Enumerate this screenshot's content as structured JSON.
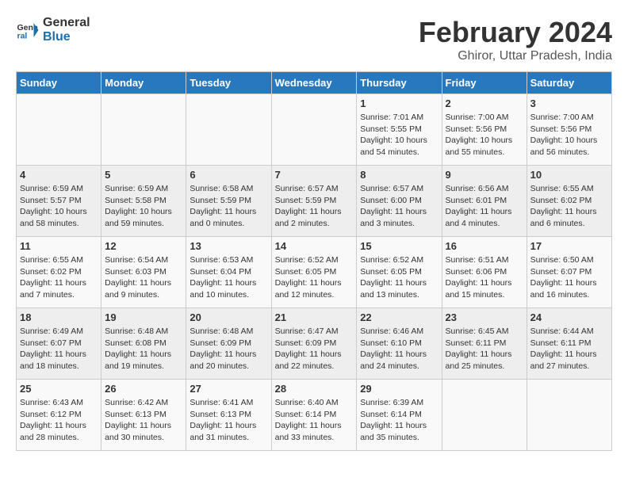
{
  "logo": {
    "line1": "General",
    "line2": "Blue"
  },
  "title": "February 2024",
  "location": "Ghiror, Uttar Pradesh, India",
  "days_of_week": [
    "Sunday",
    "Monday",
    "Tuesday",
    "Wednesday",
    "Thursday",
    "Friday",
    "Saturday"
  ],
  "weeks": [
    [
      {
        "day": "",
        "info": ""
      },
      {
        "day": "",
        "info": ""
      },
      {
        "day": "",
        "info": ""
      },
      {
        "day": "",
        "info": ""
      },
      {
        "day": "1",
        "info": "Sunrise: 7:01 AM\nSunset: 5:55 PM\nDaylight: 10 hours\nand 54 minutes."
      },
      {
        "day": "2",
        "info": "Sunrise: 7:00 AM\nSunset: 5:56 PM\nDaylight: 10 hours\nand 55 minutes."
      },
      {
        "day": "3",
        "info": "Sunrise: 7:00 AM\nSunset: 5:56 PM\nDaylight: 10 hours\nand 56 minutes."
      }
    ],
    [
      {
        "day": "4",
        "info": "Sunrise: 6:59 AM\nSunset: 5:57 PM\nDaylight: 10 hours\nand 58 minutes."
      },
      {
        "day": "5",
        "info": "Sunrise: 6:59 AM\nSunset: 5:58 PM\nDaylight: 10 hours\nand 59 minutes."
      },
      {
        "day": "6",
        "info": "Sunrise: 6:58 AM\nSunset: 5:59 PM\nDaylight: 11 hours\nand 0 minutes."
      },
      {
        "day": "7",
        "info": "Sunrise: 6:57 AM\nSunset: 5:59 PM\nDaylight: 11 hours\nand 2 minutes."
      },
      {
        "day": "8",
        "info": "Sunrise: 6:57 AM\nSunset: 6:00 PM\nDaylight: 11 hours\nand 3 minutes."
      },
      {
        "day": "9",
        "info": "Sunrise: 6:56 AM\nSunset: 6:01 PM\nDaylight: 11 hours\nand 4 minutes."
      },
      {
        "day": "10",
        "info": "Sunrise: 6:55 AM\nSunset: 6:02 PM\nDaylight: 11 hours\nand 6 minutes."
      }
    ],
    [
      {
        "day": "11",
        "info": "Sunrise: 6:55 AM\nSunset: 6:02 PM\nDaylight: 11 hours\nand 7 minutes."
      },
      {
        "day": "12",
        "info": "Sunrise: 6:54 AM\nSunset: 6:03 PM\nDaylight: 11 hours\nand 9 minutes."
      },
      {
        "day": "13",
        "info": "Sunrise: 6:53 AM\nSunset: 6:04 PM\nDaylight: 11 hours\nand 10 minutes."
      },
      {
        "day": "14",
        "info": "Sunrise: 6:52 AM\nSunset: 6:05 PM\nDaylight: 11 hours\nand 12 minutes."
      },
      {
        "day": "15",
        "info": "Sunrise: 6:52 AM\nSunset: 6:05 PM\nDaylight: 11 hours\nand 13 minutes."
      },
      {
        "day": "16",
        "info": "Sunrise: 6:51 AM\nSunset: 6:06 PM\nDaylight: 11 hours\nand 15 minutes."
      },
      {
        "day": "17",
        "info": "Sunrise: 6:50 AM\nSunset: 6:07 PM\nDaylight: 11 hours\nand 16 minutes."
      }
    ],
    [
      {
        "day": "18",
        "info": "Sunrise: 6:49 AM\nSunset: 6:07 PM\nDaylight: 11 hours\nand 18 minutes."
      },
      {
        "day": "19",
        "info": "Sunrise: 6:48 AM\nSunset: 6:08 PM\nDaylight: 11 hours\nand 19 minutes."
      },
      {
        "day": "20",
        "info": "Sunrise: 6:48 AM\nSunset: 6:09 PM\nDaylight: 11 hours\nand 20 minutes."
      },
      {
        "day": "21",
        "info": "Sunrise: 6:47 AM\nSunset: 6:09 PM\nDaylight: 11 hours\nand 22 minutes."
      },
      {
        "day": "22",
        "info": "Sunrise: 6:46 AM\nSunset: 6:10 PM\nDaylight: 11 hours\nand 24 minutes."
      },
      {
        "day": "23",
        "info": "Sunrise: 6:45 AM\nSunset: 6:11 PM\nDaylight: 11 hours\nand 25 minutes."
      },
      {
        "day": "24",
        "info": "Sunrise: 6:44 AM\nSunset: 6:11 PM\nDaylight: 11 hours\nand 27 minutes."
      }
    ],
    [
      {
        "day": "25",
        "info": "Sunrise: 6:43 AM\nSunset: 6:12 PM\nDaylight: 11 hours\nand 28 minutes."
      },
      {
        "day": "26",
        "info": "Sunrise: 6:42 AM\nSunset: 6:13 PM\nDaylight: 11 hours\nand 30 minutes."
      },
      {
        "day": "27",
        "info": "Sunrise: 6:41 AM\nSunset: 6:13 PM\nDaylight: 11 hours\nand 31 minutes."
      },
      {
        "day": "28",
        "info": "Sunrise: 6:40 AM\nSunset: 6:14 PM\nDaylight: 11 hours\nand 33 minutes."
      },
      {
        "day": "29",
        "info": "Sunrise: 6:39 AM\nSunset: 6:14 PM\nDaylight: 11 hours\nand 35 minutes."
      },
      {
        "day": "",
        "info": ""
      },
      {
        "day": "",
        "info": ""
      }
    ]
  ]
}
